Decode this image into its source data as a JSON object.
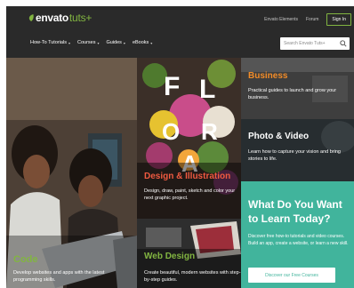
{
  "brand": {
    "envato": "envato",
    "tuts": "tuts+",
    "accent": "#82b541"
  },
  "top_links": {
    "elements": "Envato Elements",
    "forum": "Forum",
    "sign_in": "Sign In"
  },
  "nav": [
    {
      "label": "How-To Tutorials"
    },
    {
      "label": "Courses"
    },
    {
      "label": "Guides"
    },
    {
      "label": "eBooks"
    }
  ],
  "search": {
    "placeholder": "Search Envato Tuts+"
  },
  "tiles": {
    "code": {
      "title": "Code",
      "desc": "Develop websites and apps with the latest programming skills.",
      "color": "#82b541"
    },
    "design": {
      "title": "Design & Illustration",
      "desc": "Design, draw, paint, sketch and color your next graphic project.",
      "color": "#f05a40",
      "floral_letters": [
        "F",
        "L",
        "O",
        "R",
        "A"
      ]
    },
    "web": {
      "title": "Web Design",
      "desc": "Create beautiful, modern websites with step-by-step guides.",
      "color": "#82b541"
    },
    "business": {
      "title": "Business",
      "desc": "Practical guides to launch and grow your business.",
      "color": "#f28c28"
    },
    "photo": {
      "title": "Photo & Video",
      "desc": "Learn how to capture your vision and bring stories to life.",
      "color": "#ffffff"
    },
    "learn": {
      "title": "What Do You Want to Learn Today?",
      "desc": "Discover free how-to tutorials and video courses. Build an app, create a website, or learn a new skill.",
      "button": "Discover our Free Courses",
      "color": "#41b49c"
    }
  }
}
